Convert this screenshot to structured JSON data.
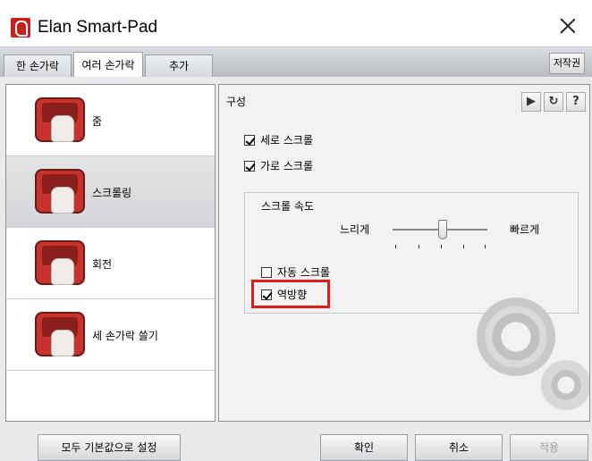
{
  "window": {
    "title": "Elan Smart-Pad"
  },
  "tabs": [
    "한 손가락",
    "여러 손가락",
    "추가"
  ],
  "author_button": "저작권",
  "gestures": [
    {
      "label": "줌",
      "icon": "zoom-gesture-icon"
    },
    {
      "label": "스크롤링",
      "icon": "scroll-gesture-icon"
    },
    {
      "label": "회전",
      "icon": "rotate-gesture-icon"
    },
    {
      "label": "세 손가락 쓸기",
      "icon": "three-finger-swipe-icon"
    }
  ],
  "panel": {
    "title": "구성",
    "vertical_scroll": {
      "label": "세로 스크롤",
      "checked": true
    },
    "horizontal_scroll": {
      "label": "가로 스크롤",
      "checked": true
    },
    "speed_group": {
      "title": "스크롤 속도",
      "slow_label": "느리게",
      "fast_label": "빠르게",
      "level": 0.5
    },
    "auto_scroll": {
      "label": "자동 스크롤",
      "checked": false
    },
    "reverse": {
      "label": "역방향",
      "checked": true
    }
  },
  "footer": {
    "reset_label": "모두 기본값으로 설정",
    "ok_label": "확인",
    "cancel_label": "취소",
    "apply_label": "적용"
  },
  "colors": {
    "accent": "#c8322c",
    "highlight": "#e21a1a"
  }
}
